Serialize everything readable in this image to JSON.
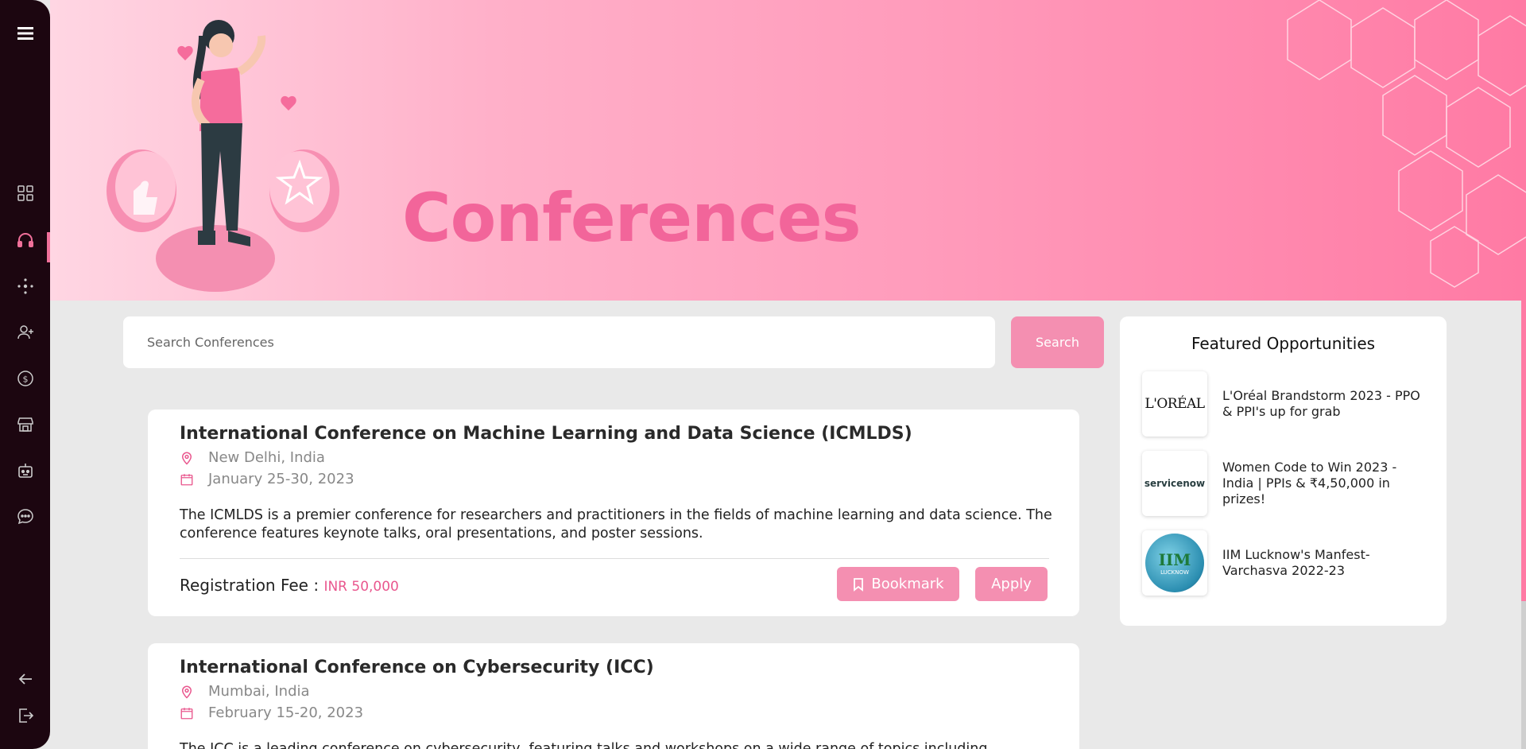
{
  "sidebar": {
    "icons": [
      "menu-icon",
      "dashboard-icon",
      "headset-icon",
      "network-icon",
      "add-user-icon",
      "money-icon",
      "store-icon",
      "bot-icon",
      "chat-icon",
      "back-arrow-icon",
      "logout-icon"
    ],
    "active": "headset-icon"
  },
  "banner": {
    "title": "Conferences"
  },
  "search": {
    "placeholder": "Search Conferences",
    "button_label": "Search"
  },
  "conferences": [
    {
      "title": "International Conference on Machine Learning and Data Science (ICMLDS)",
      "location": "New Delhi, India",
      "dates": "January 25-30, 2023",
      "description": "The ICMLDS is a premier conference for researchers and practitioners in the fields of machine learning and data science. The conference features keynote talks, oral presentations, and poster sessions.",
      "fee_label": "Registration Fee :",
      "fee_value": "INR 50,000",
      "bookmark_label": "Bookmark",
      "apply_label": "Apply"
    },
    {
      "title": "International Conference on Cybersecurity (ICC)",
      "location": "Mumbai, India",
      "dates": "February 15-20, 2023",
      "description": "The ICC is a leading conference on cybersecurity, featuring talks and workshops on a wide range of topics including"
    }
  ],
  "featured": {
    "title": "Featured Opportunities",
    "items": [
      {
        "logo_text": "L'ORÉAL",
        "text": "L'Oréal Brandstorm 2023 - PPO & PPI's up for grab"
      },
      {
        "logo_text": "servicenow",
        "text": "Women Code to Win 2023 - India | PPIs & ₹4,50,000 in prizes!"
      },
      {
        "logo_text": "IIM",
        "logo_subtext": "LUCKNOW",
        "text": "IIM Lucknow's Manfest-Varchasva 2022-23"
      }
    ]
  },
  "colors": {
    "accent": "#f48fb1",
    "accent_dark": "#e9578e",
    "sidebar": "#1c0610",
    "title_pink": "#f2659a"
  }
}
